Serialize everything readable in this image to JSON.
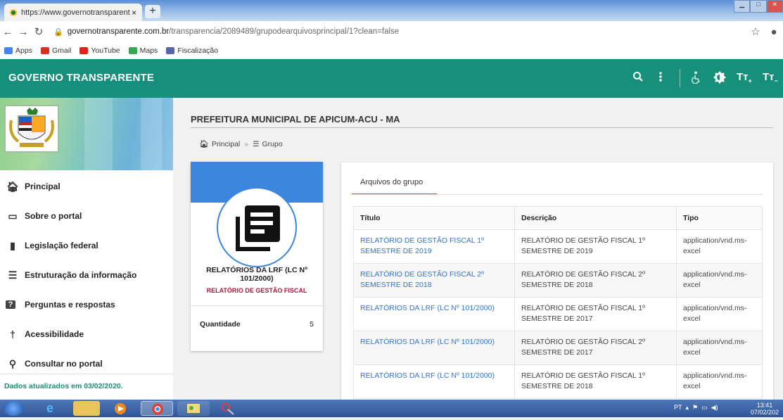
{
  "browser": {
    "tab_title": "https://www.governotransparent",
    "tab_close": "×",
    "new_tab": "+",
    "url_host": "governotransparente.com.br",
    "url_path": "/transparencia/2089489/grupodearquivosprincipal/1?clean=false",
    "bookmarks": [
      {
        "label": "Apps",
        "color": "#4285f4"
      },
      {
        "label": "Gmail",
        "color": "#d93025"
      },
      {
        "label": "YouTube",
        "color": "#e62117"
      },
      {
        "label": "Maps",
        "color": "#34a853"
      },
      {
        "label": "Fiscalização",
        "color": "#5566aa"
      }
    ]
  },
  "header": {
    "title": "GOVERNO TRANSPARENTE",
    "color": "#16907a"
  },
  "sidebar": {
    "items": [
      {
        "label": "Principal",
        "icon": "home-icon"
      },
      {
        "label": "Sobre o portal",
        "icon": "folder-icon"
      },
      {
        "label": "Legislação federal",
        "icon": "file-icon"
      },
      {
        "label": "Estruturação da informação",
        "icon": "list-icon"
      },
      {
        "label": "Perguntas e respostas",
        "icon": "help-icon"
      },
      {
        "label": "Acessibilidade",
        "icon": "accessibility-icon"
      },
      {
        "label": "Consultar no portal",
        "icon": "search-icon"
      }
    ],
    "updated": "Dados atualizados em 03/02/2020."
  },
  "main": {
    "page_title": "PREFEITURA MUNICIPAL DE APICUM-ACU - MA",
    "breadcrumb": {
      "home": "Principal",
      "current": "Grupo"
    }
  },
  "card": {
    "title": "RELATÓRIOS DA LRF (LC Nº 101/2000)",
    "subtitle": "RELATÓRIO DE GESTÃO FISCAL",
    "quantity_label": "Quantidade",
    "quantity_value": "5"
  },
  "panel": {
    "tab_label": "Arquivos do grupo",
    "columns": [
      "Título",
      "Descrição",
      "Tipo"
    ],
    "rows": [
      {
        "title": "RELATÓRIO DE GESTÃO FISCAL 1º SEMESTRE DE 2019",
        "desc": "RELATÓRIO DE GESTÃO FISCAL 1º SEMESTRE DE 2019",
        "type": "application/vnd.ms-excel"
      },
      {
        "title": "RELATÓRIO DE GESTÃO FISCAL 2º SEMESTRE DE 2018",
        "desc": "RELATÓRIO DE GESTÃO FISCAL 2º SEMESTRE DE 2018",
        "type": "application/vnd.ms-excel"
      },
      {
        "title": "RELATÓRIOS DA LRF (LC Nº 101/2000)",
        "desc": "RELATÓRIO DE GESTÃO FISCAL 1º SEMESTRE DE 2017",
        "type": "application/vnd.ms-excel"
      },
      {
        "title": "RELATÓRIOS DA LRF (LC Nº 101/2000)",
        "desc": "RELATÓRIO DE GESTÃO FISCAL 2º SEMESTRE DE 2017",
        "type": "application/vnd.ms-excel"
      },
      {
        "title": "RELATÓRIOS DA LRF (LC Nº 101/2000)",
        "desc": "RELATÓRIO DE GESTÃO FISCAL 1º SEMESTRE DE 2018",
        "type": "application/vnd.ms-excel"
      }
    ]
  },
  "taskbar": {
    "lang": "PT",
    "time": "13:41",
    "date": "07/02/202"
  }
}
